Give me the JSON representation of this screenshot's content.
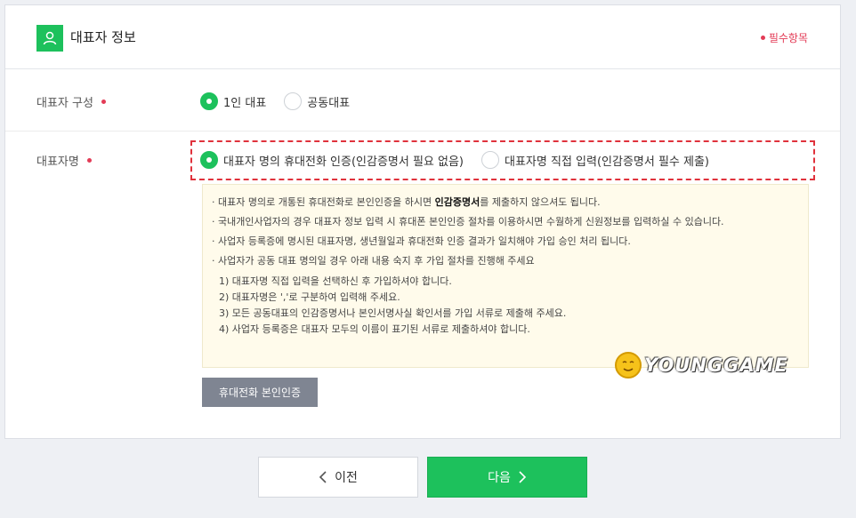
{
  "header": {
    "title": "대표자 정보",
    "required_legend": "필수항목"
  },
  "composition": {
    "label": "대표자 구성",
    "options": [
      {
        "label": "1인 대표",
        "selected": true
      },
      {
        "label": "공동대표",
        "selected": false
      }
    ]
  },
  "rep_name": {
    "label": "대표자명",
    "options": [
      {
        "label": "대표자 명의 휴대전화 인증(인감증명서 필요 없음)",
        "selected": true
      },
      {
        "label": "대표자명 직접 입력(인감증명서 필수 제출)",
        "selected": false
      }
    ]
  },
  "notice": {
    "line1_pre": "· 대표자 명의로 개통된 휴대전화로 본인인증을 하시면 ",
    "line1_bold": "인감증명서",
    "line1_post": "를 제출하지 않으셔도 됩니다.",
    "line2": "· 국내개인사업자의 경우 대표자 정보 입력 시 휴대폰 본인인증 절차를 이용하시면 수월하게 신원정보를 입력하실 수 있습니다.",
    "line3": "· 사업자 등록증에 명시된 대표자명, 생년월일과 휴대전화 인증 결과가 일치해야 가입 승인 처리 됩니다.",
    "line4": "· 사업자가 공동 대표 명의일 경우 아래 내용 숙지 후 가입 절차를 진행해 주세요",
    "steps": [
      "1) 대표자명 직접 입력을 선택하신 후 가입하셔야 합니다.",
      "2) 대표자명은 ','로 구분하여 입력해 주세요.",
      "3) 모든 공동대표의 인감증명서나 본인서명사실 확인서를 가입 서류로 제출해 주세요.",
      "4) 사업자 등록증은 대표자 모두의 이름이 표기된 서류로 제출하셔야 합니다."
    ]
  },
  "verify_button": "휴대전화 본인인증",
  "watermark": "YOUNGGAME",
  "nav": {
    "prev": "이전",
    "next": "다음"
  },
  "colors": {
    "accent": "#1dc15c",
    "required": "#e33b56",
    "highlight_border": "#e0323c",
    "notice_bg": "#fffbeb",
    "button_gray": "#7f8592"
  },
  "icons": [
    "user-icon",
    "chevron-left-icon",
    "chevron-right-icon"
  ]
}
